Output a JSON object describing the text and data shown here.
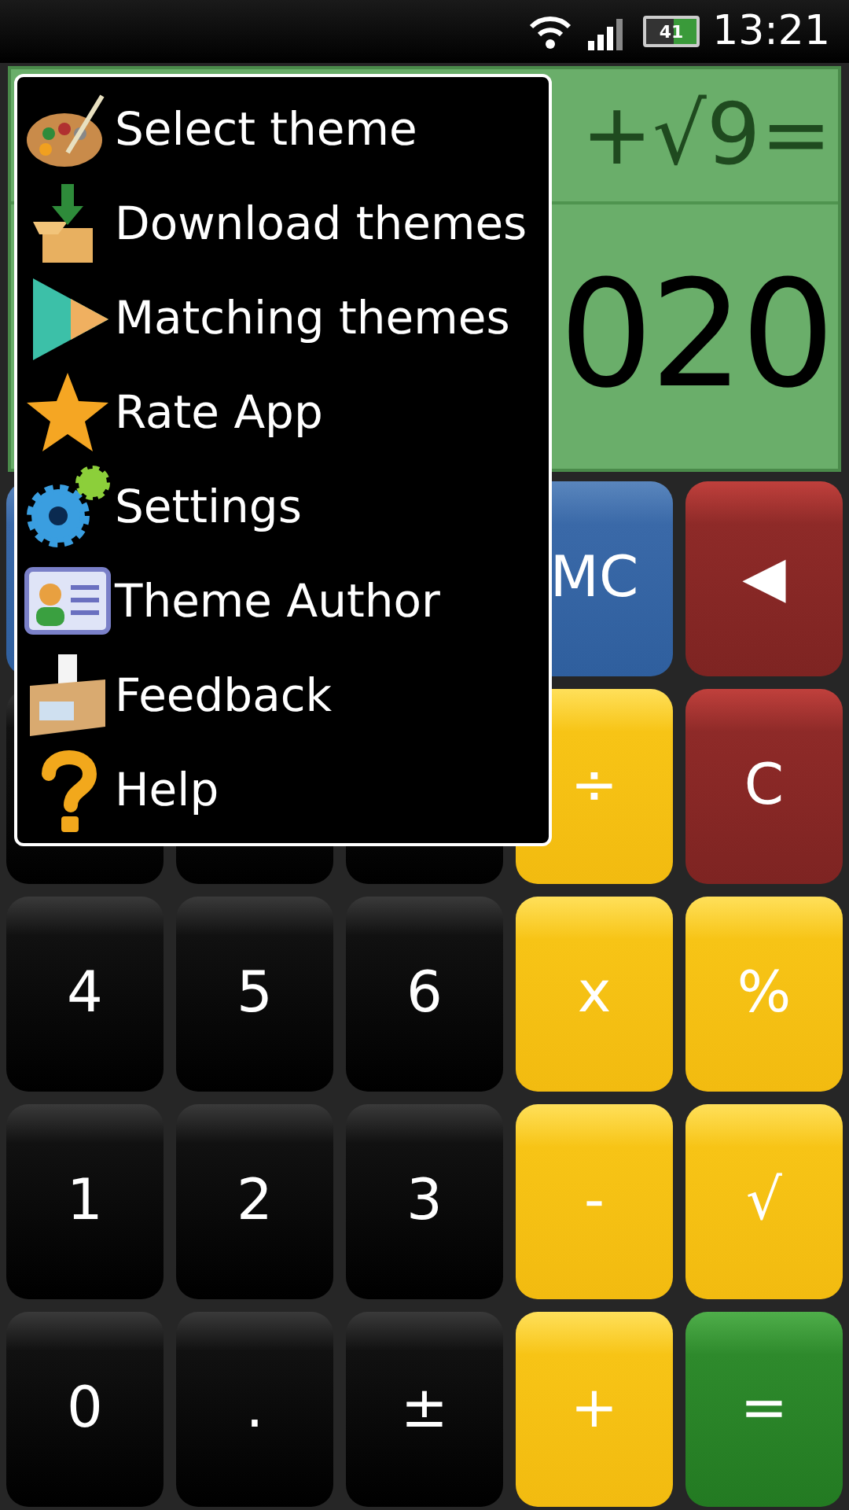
{
  "status_bar": {
    "battery": "41",
    "time": "13:21"
  },
  "display": {
    "expression": "+√9=",
    "result": "020"
  },
  "keys": [
    {
      "kind": "blue"
    },
    {
      "kind": "blue",
      "label": "MC"
    },
    {
      "kind": "red",
      "label": "◀"
    },
    {
      "kind": "black"
    },
    {
      "kind": "black"
    },
    {
      "kind": "black"
    },
    {
      "kind": "yellow",
      "label": "÷"
    },
    {
      "kind": "red",
      "label": "C"
    },
    {
      "kind": "black",
      "label": "4"
    },
    {
      "kind": "black",
      "label": "5"
    },
    {
      "kind": "black",
      "label": "6"
    },
    {
      "kind": "yellow",
      "label": "x"
    },
    {
      "kind": "yellow",
      "label": "%"
    },
    {
      "kind": "black",
      "label": "1"
    },
    {
      "kind": "black",
      "label": "2"
    },
    {
      "kind": "black",
      "label": "3"
    },
    {
      "kind": "yellow",
      "label": "-"
    },
    {
      "kind": "yellow",
      "label": "√"
    },
    {
      "kind": "black",
      "label": "0"
    },
    {
      "kind": "black",
      "label": "."
    },
    {
      "kind": "black",
      "label": "±"
    },
    {
      "kind": "yellow",
      "label": "+"
    },
    {
      "kind": "green",
      "label": "="
    }
  ],
  "menu": [
    {
      "label": "Select theme"
    },
    {
      "label": "Download themes"
    },
    {
      "label": "Matching themes"
    },
    {
      "label": "Rate App"
    },
    {
      "label": "Settings"
    },
    {
      "label": "Theme Author"
    },
    {
      "label": "Feedback"
    },
    {
      "label": "Help"
    }
  ]
}
